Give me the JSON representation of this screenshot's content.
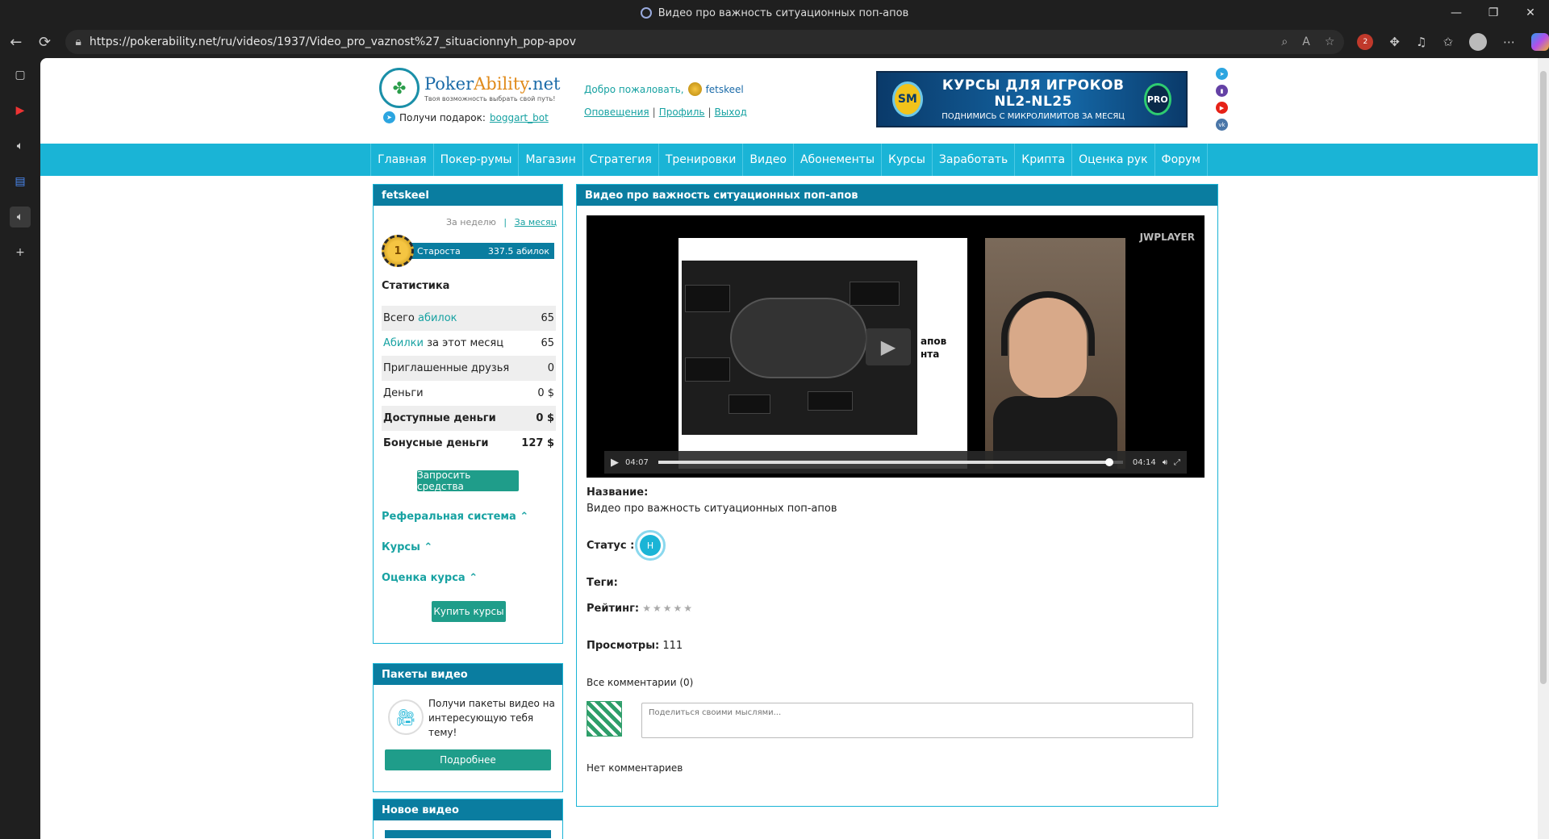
{
  "browser": {
    "tab_title": "Видео про важность ситуационных поп-апов",
    "url": "https://pokerability.net/ru/videos/1937/Video_pro_vaznost%27_situacionnyh_pop-apov",
    "ext_badge": "2"
  },
  "site": {
    "logo_name_a": "Poker",
    "logo_name_b": "Ability",
    "logo_name_c": ".net",
    "logo_slogan": "Твоя возможность выбрать свой путь!",
    "gift_label": "Получи подарок:",
    "gift_link": "boggart_bot",
    "welcome": "Добро пожаловать,",
    "username": "fetskeel",
    "links": [
      "Оповещения",
      "Профиль",
      "Выход"
    ],
    "banner": {
      "badge": "SM",
      "line1": "КУРСЫ ДЛЯ ИГРОКОВ NL2-NL25",
      "line2": "ПОДНИМИСЬ С МИКРОЛИМИТОВ ЗА МЕСЯЦ",
      "pro": "PRO"
    }
  },
  "menu": [
    "Главная",
    "Покер-румы",
    "Магазин",
    "Стратегия",
    "Тренировки",
    "Видео",
    "Абонементы",
    "Курсы",
    "Заработать",
    "Крипта",
    "Оценка рук",
    "Форум"
  ],
  "userpanel": {
    "title": "fetskeel",
    "period_week": "За неделю",
    "period_month": "За месяц",
    "rank_name": "Староста",
    "rank_value": "337.5 абилок",
    "rank_coin": "1",
    "stats_title": "Статистика",
    "stats": [
      {
        "pre": "Всего ",
        "hl": "абилок",
        "post": "",
        "value": "65"
      },
      {
        "pre": "",
        "hl": "Абилки",
        "post": " за этот месяц",
        "value": "65"
      },
      {
        "pre": "Приглашенные друзья",
        "hl": "",
        "post": "",
        "value": "0"
      },
      {
        "pre": "Деньги",
        "hl": "",
        "post": "",
        "value": "0 $"
      },
      {
        "pre": "Доступные деньги",
        "hl": "",
        "post": "",
        "value": "0 $"
      },
      {
        "pre": "Бонусные деньги",
        "hl": "",
        "post": "",
        "value": "127 $"
      }
    ],
    "request_btn": "Запросить средства",
    "ref_system": "Реферальная система",
    "courses": "Курсы",
    "course_rating": "Оценка курса",
    "buy_courses": "Купить курсы"
  },
  "videopack": {
    "title": "Пакеты видео",
    "text": "Получи пакеты видео на интересующую тебя тему!",
    "button": "Подробнее"
  },
  "newvideo": {
    "title": "Новое видео"
  },
  "video": {
    "title": "Видео про важность ситуационных поп-апов",
    "player_brand": "JWPLAYER",
    "slide_text_a": "апов",
    "slide_text_b": "нта",
    "elapsed": "04:07",
    "duration": "04:14",
    "progress": 0.97,
    "name_label": "Название:",
    "name_value": "Видео про важность ситуационных поп-апов",
    "status_label": "Статус :",
    "status_badge": "H",
    "tags_label": "Теги:",
    "rating_label": "Рейтинг:",
    "rating_stars": "★★★★★",
    "views_label": "Просмотры:",
    "views_value": "111",
    "comments_label": "Все комментарии (0)",
    "comment_placeholder": "Поделиться своими мыслями...",
    "no_comments": "Нет комментариев"
  },
  "colors": {
    "menu_bg": "#1ab4d6",
    "panel_head": "#0a7da0",
    "green_btn": "#1f9d8a",
    "link": "#17a2a2"
  }
}
